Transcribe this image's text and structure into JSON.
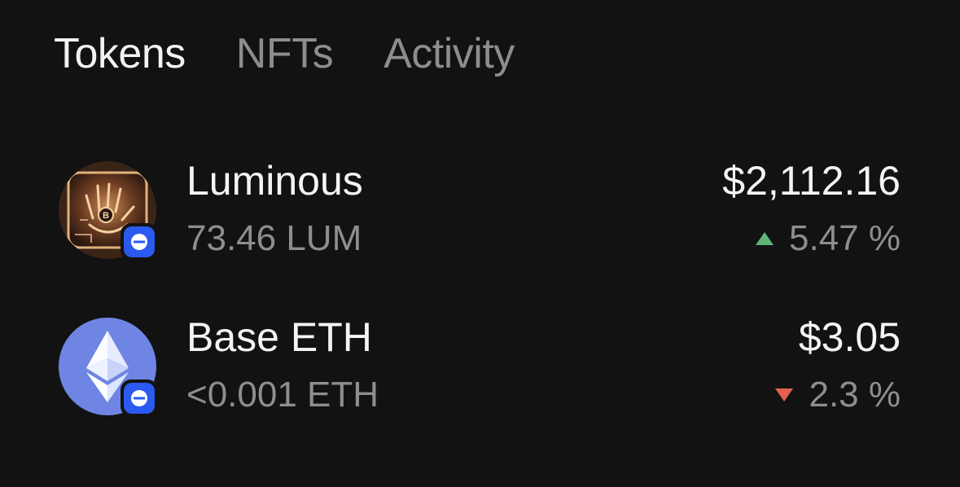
{
  "tabs": [
    {
      "label": "Tokens",
      "active": true
    },
    {
      "label": "NFTs",
      "active": false
    },
    {
      "label": "Activity",
      "active": false
    }
  ],
  "tokens": [
    {
      "name": "Luminous",
      "amount": "73.46 LUM",
      "value": "$2,112.16",
      "change": "5.47 %",
      "direction": "up",
      "icon": "luminous-hand-icon",
      "badge_icon": "base-network-icon"
    },
    {
      "name": "Base ETH",
      "amount": "<0.001 ETH",
      "value": "$3.05",
      "change": "2.3 %",
      "direction": "down",
      "icon": "ethereum-icon",
      "badge_icon": "base-network-icon"
    }
  ],
  "colors": {
    "background": "#121212",
    "up": "#5fb578",
    "down": "#e0624d",
    "badge": "#2b5af0",
    "eth_circle": "#6e85e3"
  }
}
